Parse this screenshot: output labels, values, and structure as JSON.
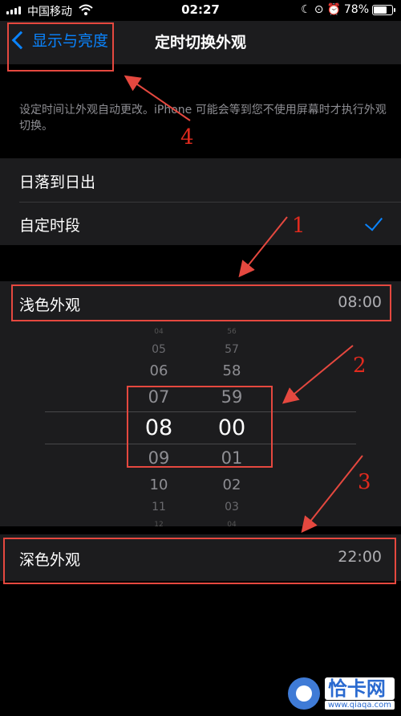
{
  "status_bar": {
    "carrier": "中国移动",
    "time": "02:27",
    "battery_percent": "78%",
    "battery_level": 0.78,
    "icons": [
      "signal-icon",
      "wifi-icon",
      "moon-icon",
      "lock-rotation-icon",
      "alarm-icon",
      "battery-icon"
    ]
  },
  "nav": {
    "back_label": "显示与亮度",
    "title": "定时切换外观"
  },
  "description": "设定时间让外观自动更改。iPhone 可能会等到您不使用屏幕时才执行外观切换。",
  "schedule_options": [
    {
      "label": "日落到日出",
      "selected": false
    },
    {
      "label": "自定时段",
      "selected": true
    }
  ],
  "light_appearance": {
    "label": "浅色外观",
    "time": "08:00"
  },
  "picker": {
    "hours": [
      "04",
      "05",
      "06",
      "07",
      "08",
      "09",
      "10",
      "11",
      "12"
    ],
    "minutes": [
      "56",
      "57",
      "58",
      "59",
      "00",
      "01",
      "02",
      "03",
      "04"
    ],
    "selected_hour": "08",
    "selected_minute": "00"
  },
  "dark_appearance": {
    "label": "深色外观",
    "time": "22:00"
  },
  "annotations": {
    "labels": [
      "1",
      "2",
      "3",
      "4"
    ],
    "color": "#e5483f"
  },
  "watermark": {
    "main": "恰卡网",
    "sub": "www.qiaqa.com"
  },
  "colors": {
    "accent": "#0a84ff",
    "background": "#000000",
    "cell": "#1c1c1e"
  }
}
